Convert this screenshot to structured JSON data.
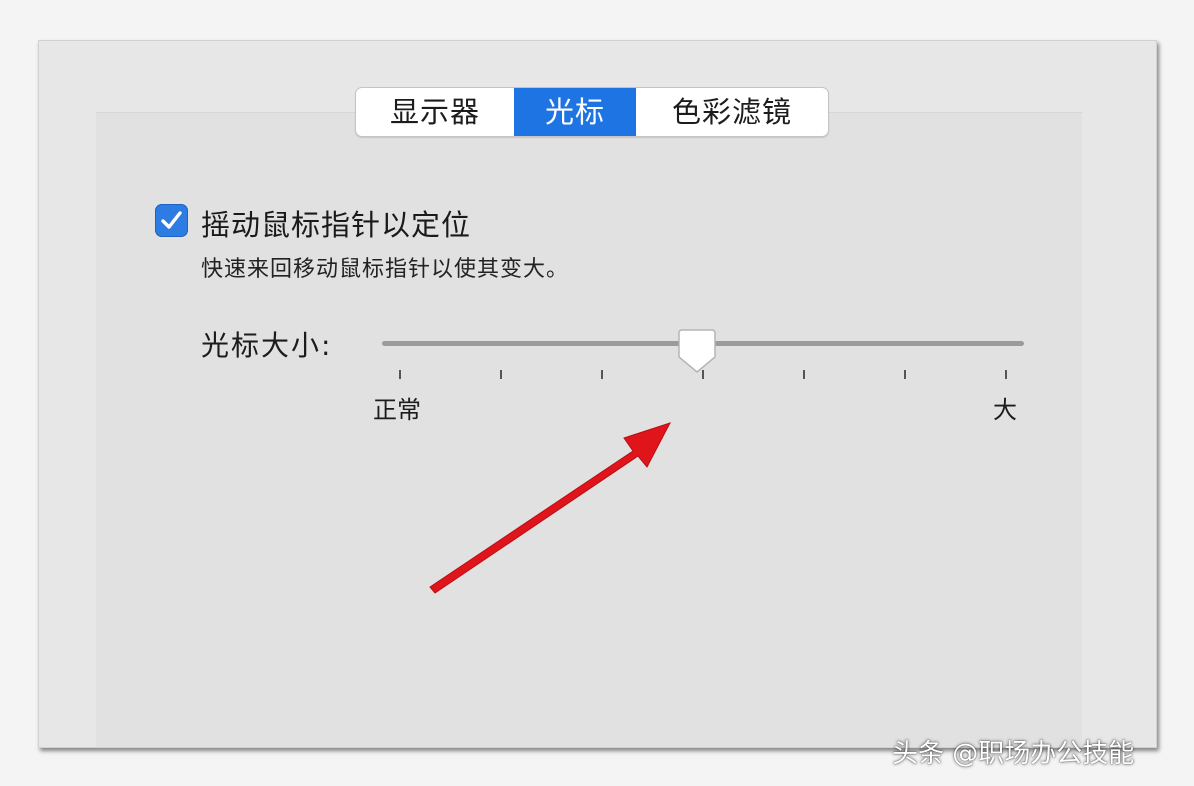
{
  "tabs": [
    {
      "label": "显示器",
      "active": false
    },
    {
      "label": "光标",
      "active": true
    },
    {
      "label": "色彩滤镜",
      "active": false
    }
  ],
  "shake_to_locate": {
    "checked": true,
    "label": "摇动鼠标指针以定位",
    "description": "快速来回移动鼠标指针以使其变大。"
  },
  "cursor_size": {
    "label": "光标大小:",
    "min_label": "正常",
    "max_label": "大",
    "tick_count": 7,
    "value_fraction": 0.49
  },
  "watermark": {
    "text": "头条 @职场办公技能"
  },
  "colors": {
    "accent": "#1f74e3",
    "checkbox": "#2d7ce3",
    "annotation_arrow": "#e0141b"
  },
  "icons": {
    "checkbox": "checkmark-icon",
    "annotation": "red-arrow-icon"
  }
}
